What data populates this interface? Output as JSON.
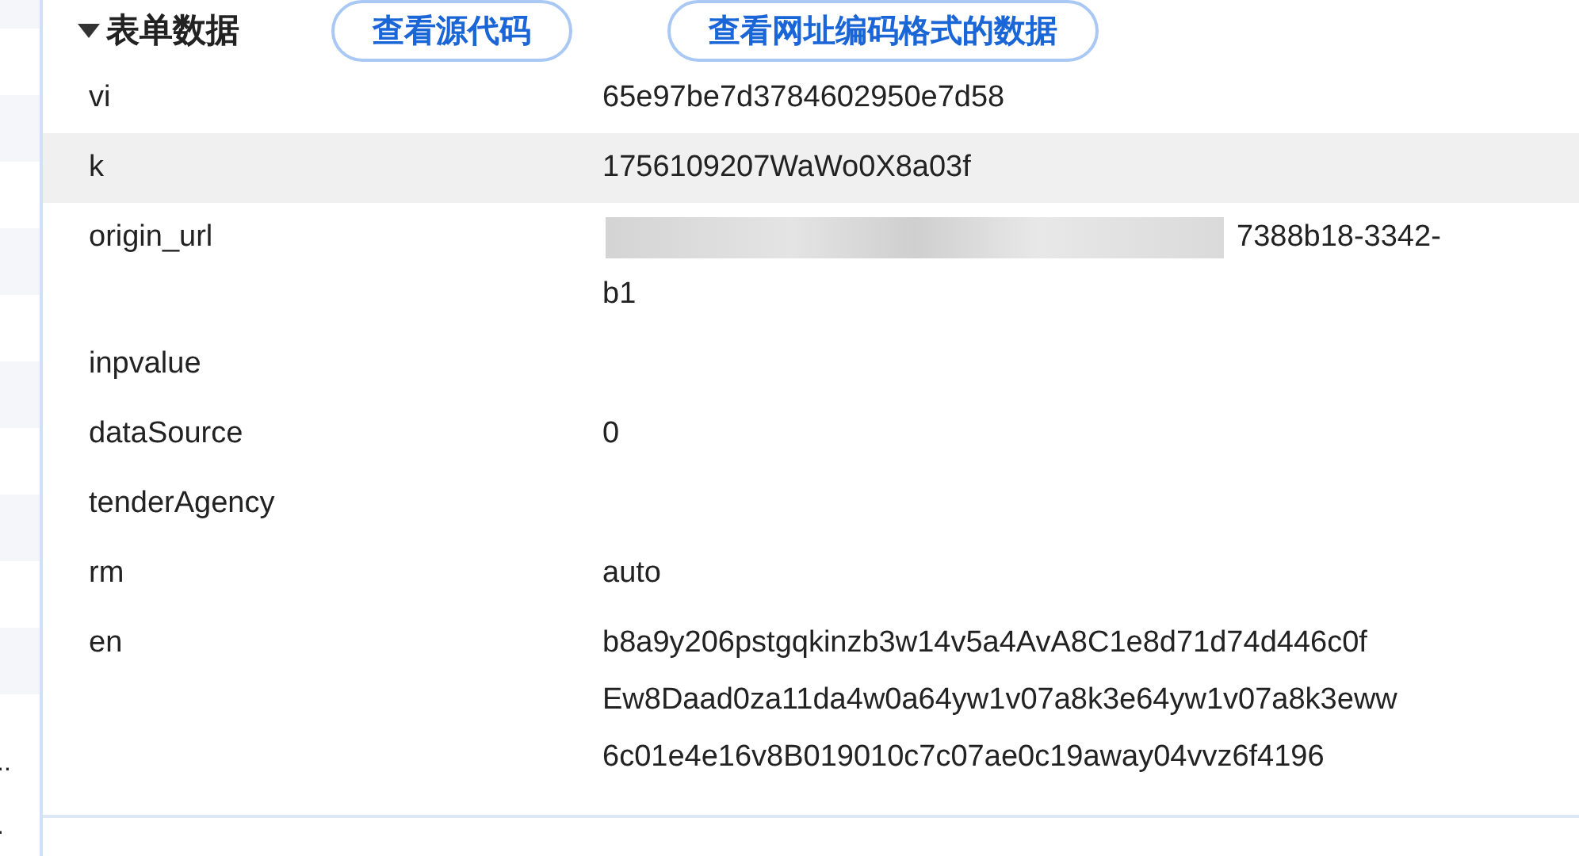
{
  "left_list": {
    "labels": [
      "..",
      "."
    ]
  },
  "section": {
    "title": "表单数据",
    "expanded": true,
    "buttons": [
      "查看源代码",
      "查看网址编码格式的数据"
    ]
  },
  "rows": [
    {
      "key": "vi",
      "value_lines": [
        "65e97be7d3784602950e7d58"
      ],
      "selected": false
    },
    {
      "key": "k",
      "value_lines": [
        "1756109207WaWo0X8a03f"
      ],
      "selected": true
    },
    {
      "key": "origin_url",
      "value_lines": [
        "7388b18-3342-",
        "b1"
      ],
      "selected": false,
      "redacted": true
    },
    {
      "key": "inpvalue",
      "value_lines": [],
      "selected": false
    },
    {
      "key": "dataSource",
      "value_lines": [
        "0"
      ],
      "selected": false
    },
    {
      "key": "tenderAgency",
      "value_lines": [],
      "selected": false
    },
    {
      "key": "rm",
      "value_lines": [
        "auto"
      ],
      "selected": false
    },
    {
      "key": "en",
      "value_lines": [
        "b8a9y206pstgqkinzb3w14v5a4AvA8C1e8d71d74d446c0f",
        "Ew8Daad0za11da4w0a64yw1v07a8k3e64yw1v07a8k3eww",
        "6c01e4e16v8B019010c7c07ae0c19away04vvz6f4196"
      ],
      "selected": false
    }
  ]
}
